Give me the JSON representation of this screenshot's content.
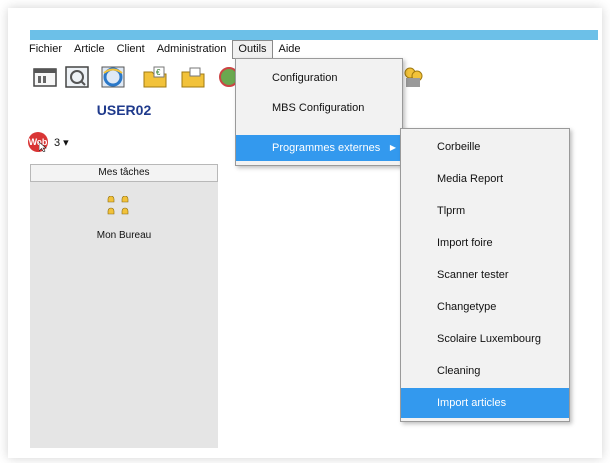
{
  "menubar": {
    "items": [
      "Fichier",
      "Article",
      "Client",
      "Administration",
      "Outils",
      "Aide"
    ]
  },
  "left_panel": {
    "user": "USER02",
    "web_badge": "Web",
    "web_count": "3 ▾",
    "tasks_header": "Mes tâches",
    "bureau_label": "Mon Bureau"
  },
  "outils_menu": {
    "items": [
      "Configuration",
      "MBS Configuration",
      "Programmes externes"
    ]
  },
  "programmes_menu": {
    "items": [
      "Corbeille",
      "Media Report",
      "Tlprm",
      "Import foire",
      "Scanner tester",
      "Changetype",
      "Scolaire Luxembourg",
      "Cleaning",
      "Import articles"
    ]
  },
  "colors": {
    "accent": "#3399ee",
    "titlebar": "#6cc0e8",
    "user": "#1f3a8c",
    "web_badge": "#d93535"
  },
  "icons": [
    "window-icon",
    "preview-icon",
    "ie-icon",
    "folder-euro-icon",
    "folder-icon",
    "tools-icon",
    "users-icon"
  ]
}
